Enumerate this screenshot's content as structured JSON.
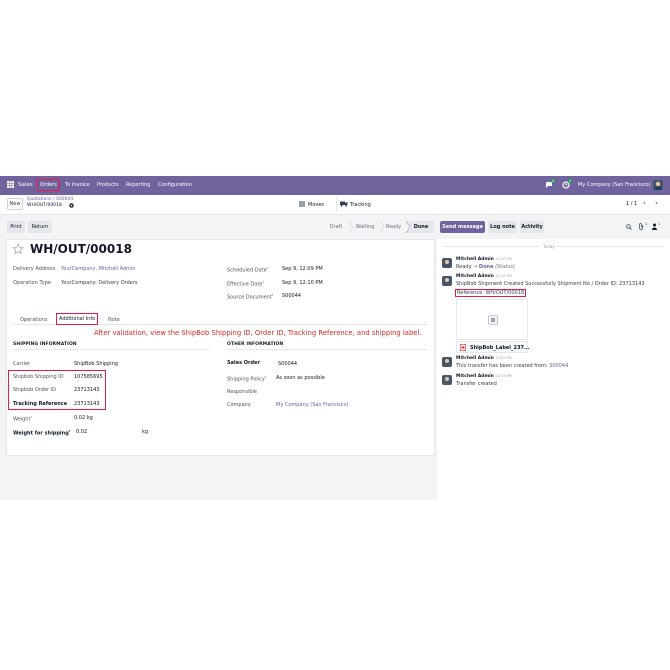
{
  "topbar": {
    "app": "Sales",
    "menu": [
      "Orders",
      "To Invoice",
      "Products",
      "Reporting",
      "Configuration"
    ],
    "company": "My Company (San Francisco)",
    "msg_badge": "4",
    "activity_badge": "4"
  },
  "breadcrumb": {
    "new_label": "New",
    "path": "Quotations / S00044",
    "current": "WH/OUT/00018"
  },
  "smart_buttons": {
    "moves": "Moves",
    "tracking": "Tracking"
  },
  "pager": "1 / 1",
  "actions": {
    "print": "Print",
    "return": "Return",
    "stages": [
      "Draft",
      "Waiting",
      "Ready",
      "Done"
    ]
  },
  "chatter_actions": {
    "send": "Send message",
    "log": "Log note",
    "activity": "Activity",
    "attachments_count": "1",
    "followers_count": "1"
  },
  "record": {
    "title": "WH/OUT/00018",
    "delivery_address_label": "Delivery Address",
    "delivery_address": "YourCompany, Mitchell Admin",
    "operation_type_label": "Operation Type",
    "operation_type": "YourCompany: Delivery Orders",
    "scheduled_label": "Scheduled Date",
    "scheduled": "Sep 9, 12:09 PM",
    "effective_label": "Effective Date",
    "effective": "Sep 9, 12:10 PM",
    "source_label": "Source Document",
    "source": "S00044"
  },
  "tabs": [
    "Operations",
    "Additional Info",
    "Note"
  ],
  "annotation": "After validation, view the ShipBob Shipping ID, Order ID, Tracking Reference, and shipping label.",
  "shipping": {
    "section": "SHIPPING INFORMATION",
    "carrier_label": "Carrier",
    "carrier": "ShipBob Shipping",
    "ship_id_label": "Shipbob Shipping ID",
    "ship_id": "107585695",
    "order_id_label": "Shipbob Order ID",
    "order_id": "23713143",
    "tracking_label": "Tracking Reference",
    "tracking": "23713143",
    "weight_label": "Weight",
    "weight": "0.02 kg",
    "weight_ship_label": "Weight for shipping",
    "weight_ship": "0.02",
    "weight_ship_unit": "kg"
  },
  "other": {
    "section": "OTHER INFORMATION",
    "sales_order_label": "Sales Order",
    "sales_order": "S00044",
    "policy_label": "Shipping Policy",
    "policy": "As soon as possible",
    "responsible_label": "Responsible",
    "company_label": "Company",
    "company": "My Company (San Francisco)"
  },
  "chatter": {
    "today": "Today",
    "messages": [
      {
        "author": "Mitchell Admin",
        "time": "12:10 PM",
        "line1_from": "Ready",
        "line1_arrow": "→",
        "line1_to": "Done",
        "line1_field": "(Status)"
      },
      {
        "author": "Mitchell Admin",
        "time": "12:10 PM",
        "line1": "ShipBob Shipment Created Successfully Shipment No / Order ID: 23713143",
        "line2": "Reference: WH/OUT/00018",
        "attachment": "ShipBob_Label_237..."
      },
      {
        "author": "Mitchell Admin",
        "time": "12:09 PM",
        "line1": "This transfer has been created from:",
        "link": "S00044"
      },
      {
        "author": "Mitchell Admin",
        "time": "12:09 PM",
        "line1": "Transfer created"
      }
    ]
  }
}
